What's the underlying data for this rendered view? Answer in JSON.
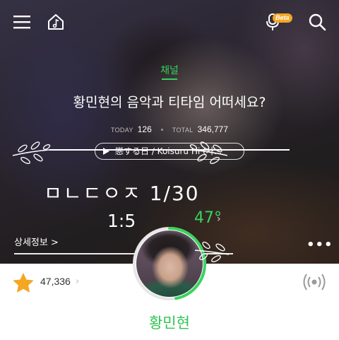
{
  "header": {
    "menu_icon": "hamburger-menu-icon",
    "home_icon": "music-home-icon",
    "mic_icon": "microphone-icon",
    "beta_label": "Beta",
    "search_icon": "search-icon"
  },
  "channel": {
    "label": "채널",
    "title": "황민현의 음악과 티타임 어떠세요?",
    "today_label": "TODAY",
    "today_count": "126",
    "total_label": "TOTAL",
    "total_count": "346,777",
    "bgm_text": "戀する日 / Koisuru Hi (사..."
  },
  "overlay": {
    "date_text": "ㅁㄴㄷㅇㅈ 1/30",
    "ratio_text": "1:5"
  },
  "temperature": {
    "value": "47°",
    "chevron": "›"
  },
  "detail": {
    "link_label": "상세정보 >",
    "more_icon": "more-dots-icon",
    "more_label": "•••"
  },
  "profile": {
    "name": "황민현",
    "likes": "47,336",
    "like_chevron": "›",
    "temperature_ring_fraction": 0.47
  },
  "colors": {
    "accent": "#33d35e",
    "beta_badge": "#f5a623",
    "star": "#f5a623"
  }
}
